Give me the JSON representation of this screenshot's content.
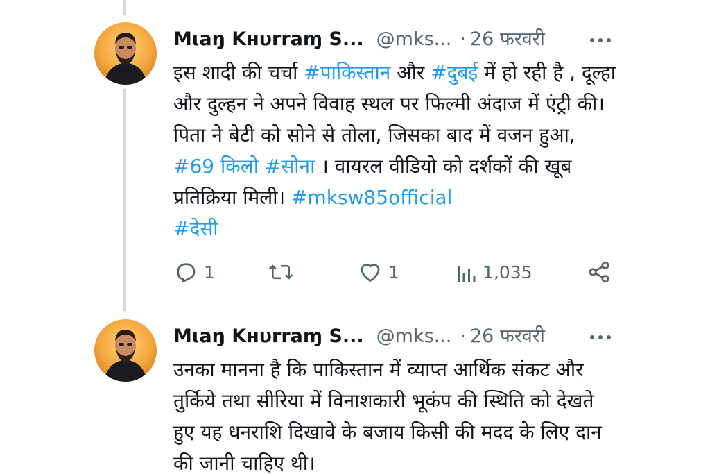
{
  "tweets": [
    {
      "author_name": "Mιaŋ Kнυrraɱ S...",
      "handle": "@mks...",
      "separator": "·",
      "date": "26 फरवरी",
      "segments": [
        {
          "text": "इस शादी की चर्चा ",
          "tag": false
        },
        {
          "text": "#पाकिस्तान",
          "tag": true
        },
        {
          "text": " और ",
          "tag": false
        },
        {
          "text": "#दुबई",
          "tag": true
        },
        {
          "text": " में हो रही है , दूल्हा और दुल्हन ने अपने विवाह स्थल पर फिल्मी अंदाज में एंट्री की। पिता ने बेटी को सोने से तोला, जिसका बाद में वजन हुआ, ",
          "tag": false
        },
        {
          "text": "#69 किलो",
          "tag": true
        },
        {
          "text": " ",
          "tag": false
        },
        {
          "text": "#सोना",
          "tag": true
        },
        {
          "text": " । वायरल वीडियो को दर्शकों की खूब प्रतिक्रिया मिली। ",
          "tag": false
        },
        {
          "text": "#mksw85official",
          "tag": true
        },
        {
          "text": " ",
          "tag": false
        },
        {
          "text": "#देसी",
          "tag": true
        }
      ],
      "reply_count": "1",
      "retweet_count": "",
      "like_count": "1",
      "view_count": "1,035"
    },
    {
      "author_name": "Mιaŋ Kнυrraɱ S...",
      "handle": "@mks...",
      "separator": "·",
      "date": "26 फरवरी",
      "body": "उनका मानना है कि पाकिस्तान में व्याप्त आर्थिक संकट और तुर्किये तथा सीरिया में विनाशकारी भूकंप की स्थिति को देखते हुए यह धनराशि दिखावे के बजाय किसी की मदद के लिए दान की जानी चाहिए थी।"
    }
  ],
  "colors": {
    "link": "#1d9bf0",
    "muted": "#536471",
    "text": "#0f1419",
    "thread_line": "#cfd9de"
  },
  "icons": {
    "reply": "reply-icon",
    "retweet": "retweet-icon",
    "like": "heart-icon",
    "views": "views-icon",
    "share": "share-icon",
    "more": "more-options-icon"
  }
}
